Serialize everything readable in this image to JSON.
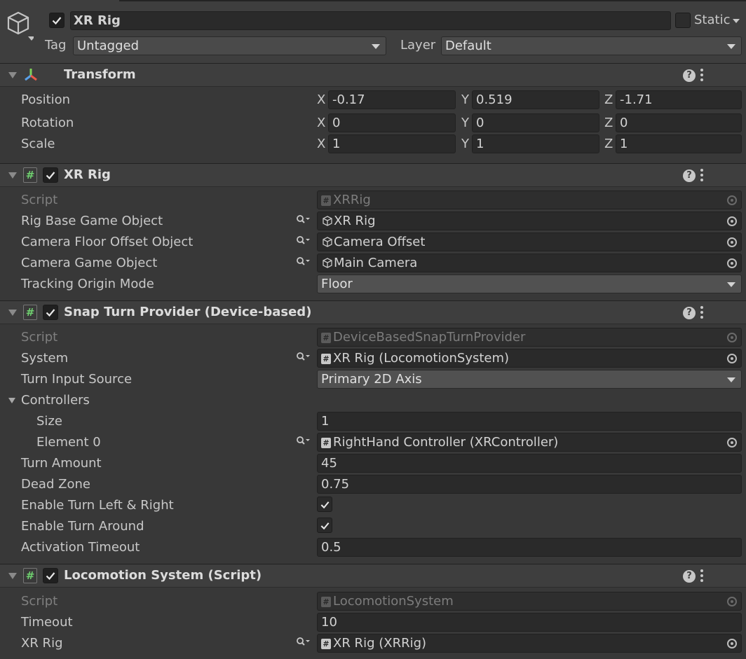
{
  "header": {
    "object_name": "XR Rig",
    "active": true,
    "static_label": "Static",
    "static_checked": false,
    "tag_label": "Tag",
    "tag_value": "Untagged",
    "layer_label": "Layer",
    "layer_value": "Default"
  },
  "transform": {
    "title": "Transform",
    "position": {
      "label": "Position",
      "x": "-0.17",
      "y": "0.519",
      "z": "-1.71"
    },
    "rotation": {
      "label": "Rotation",
      "x": "0",
      "y": "0",
      "z": "0"
    },
    "scale": {
      "label": "Scale",
      "x": "1",
      "y": "1",
      "z": "1"
    },
    "axis_x": "X",
    "axis_y": "Y",
    "axis_z": "Z"
  },
  "xr_rig": {
    "title": "XR Rig",
    "enabled": true,
    "script_label": "Script",
    "script_value": "XRRig",
    "rig_base_label": "Rig Base Game Object",
    "rig_base_value": "XR Rig",
    "camera_floor_label": "Camera Floor Offset Object",
    "camera_floor_value": "Camera Offset",
    "camera_go_label": "Camera Game Object",
    "camera_go_value": "Main Camera",
    "tracking_label": "Tracking Origin Mode",
    "tracking_value": "Floor"
  },
  "snap_turn": {
    "title": "Snap Turn Provider (Device-based)",
    "enabled": true,
    "script_label": "Script",
    "script_value": "DeviceBasedSnapTurnProvider",
    "system_label": "System",
    "system_value": "XR Rig (LocomotionSystem)",
    "turn_input_label": "Turn Input Source",
    "turn_input_value": "Primary 2D Axis",
    "controllers_label": "Controllers",
    "size_label": "Size",
    "size_value": "1",
    "element0_label": "Element 0",
    "element0_value": "RightHand Controller (XRController)",
    "turn_amount_label": "Turn Amount",
    "turn_amount_value": "45",
    "dead_zone_label": "Dead Zone",
    "dead_zone_value": "0.75",
    "enable_lr_label": "Enable Turn Left & Right",
    "enable_lr_checked": true,
    "enable_around_label": "Enable Turn Around",
    "enable_around_checked": true,
    "activation_label": "Activation Timeout",
    "activation_value": "0.5"
  },
  "locomotion": {
    "title": "Locomotion System (Script)",
    "enabled": true,
    "script_label": "Script",
    "script_value": "LocomotionSystem",
    "timeout_label": "Timeout",
    "timeout_value": "10",
    "xr_rig_label": "XR Rig",
    "xr_rig_value": "XR Rig (XRRig)"
  },
  "icons": [
    "gameobject-cube-icon",
    "check-icon",
    "transform-axes-icon",
    "script-hash-icon",
    "help-icon",
    "presets-icon",
    "kebab-menu-icon",
    "object-picker-icon",
    "target-icon",
    "dropdown-arrow-icon",
    "foldout-arrow-icon"
  ]
}
